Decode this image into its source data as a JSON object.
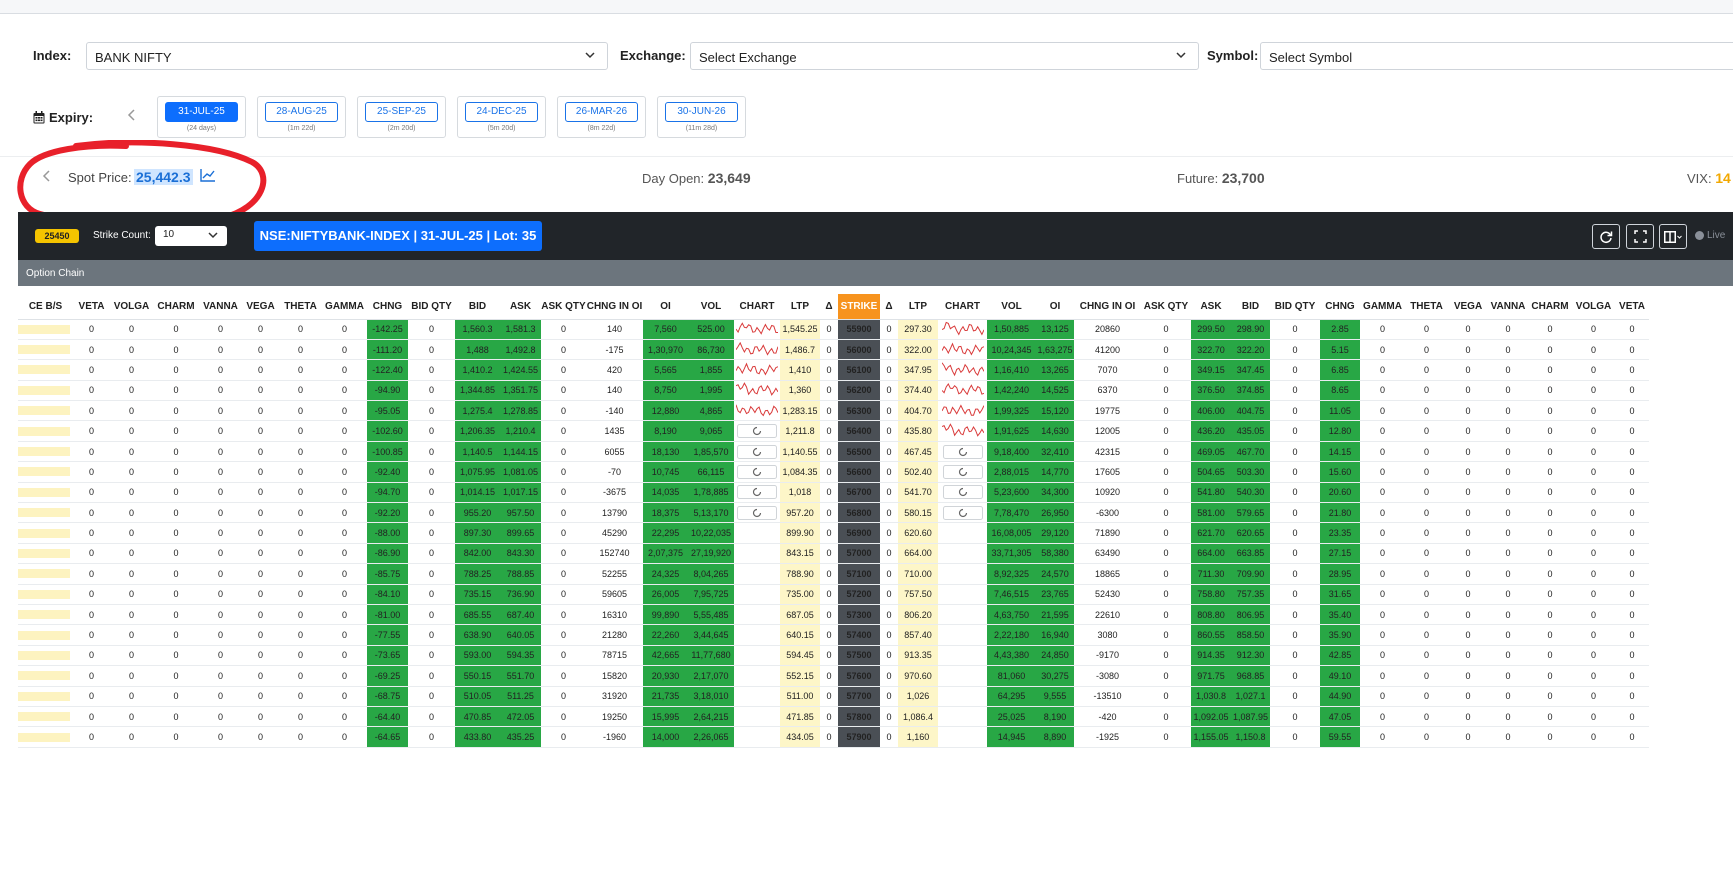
{
  "filters": {
    "index_label": "Index:",
    "index_value": "BANK NIFTY",
    "exchange_label": "Exchange:",
    "exchange_placeholder": "Select Exchange",
    "symbol_label": "Symbol:",
    "symbol_placeholder": "Select Symbol"
  },
  "expiry": {
    "label": "Expiry:",
    "items": [
      {
        "date": "31-JUL-25",
        "sub": "(24 days)",
        "active": true
      },
      {
        "date": "28-AUG-25",
        "sub": "(1m 22d)",
        "active": false
      },
      {
        "date": "25-SEP-25",
        "sub": "(2m 20d)",
        "active": false
      },
      {
        "date": "24-DEC-25",
        "sub": "(5m 20d)",
        "active": false
      },
      {
        "date": "26-MAR-26",
        "sub": "(8m 22d)",
        "active": false
      },
      {
        "date": "30-JUN-26",
        "sub": "(11m 28d)",
        "active": false
      }
    ]
  },
  "spot": {
    "label": "Spot Price:",
    "value": "25,442.3",
    "day_open_label": "Day Open:",
    "day_open_value": "23,649",
    "future_label": "Future:",
    "future_value": "23,700",
    "vix_label": "VIX:",
    "vix_value": "14"
  },
  "toolbar": {
    "spot_badge": "25450",
    "strike_count_label": "Strike Count:",
    "strike_count_value": "10",
    "instrument": "NSE:NIFTYBANK-INDEX | 31-JUL-25 | Lot: 35",
    "live_label": "Live"
  },
  "option_chain": {
    "title": "Option Chain",
    "columns": [
      "CE B/S",
      "VETA",
      "VOLGA",
      "CHARM",
      "VANNA",
      "VEGA",
      "THETA",
      "GAMMA",
      "CHNG",
      "BID QTY",
      "BID",
      "ASK",
      "ASK QTY",
      "CHNG IN OI",
      "OI",
      "VOL",
      "CHART",
      "LTP",
      "Δ",
      "STRIKE",
      "Δ",
      "LTP",
      "CHART",
      "VOL",
      "OI",
      "CHNG IN OI",
      "ASK QTY",
      "ASK",
      "BID",
      "BID QTY",
      "CHNG",
      "GAMMA",
      "THETA",
      "VEGA",
      "VANNA",
      "CHARM",
      "VOLGA",
      "VETA"
    ],
    "rows": [
      {
        "strike": "55900",
        "ce_chng": "-142.25",
        "ce_bid": "1,560.3",
        "ce_ask": "1,581.3",
        "ce_coi": "140",
        "ce_oi": "7,560",
        "ce_vol": "525.00",
        "ce_chart": "spark",
        "ce_ltp": "1,545.25",
        "pe_ltp": "297.30",
        "pe_chart": "spark",
        "pe_vol": "1,50,885",
        "pe_oi": "13,125",
        "pe_coi": "20860",
        "pe_ask": "299.50",
        "pe_bid": "298.90",
        "pe_chng": "2.85"
      },
      {
        "strike": "56000",
        "ce_chng": "-111.20",
        "ce_bid": "1,488",
        "ce_ask": "1,492.8",
        "ce_coi": "-175",
        "ce_oi": "1,30,970",
        "ce_vol": "86,730",
        "ce_chart": "spark",
        "ce_ltp": "1,486.7",
        "pe_ltp": "322.00",
        "pe_chart": "spark",
        "pe_vol": "10,24,345",
        "pe_oi": "1,63,275",
        "pe_coi": "41200",
        "pe_ask": "322.70",
        "pe_bid": "322.20",
        "pe_chng": "5.15"
      },
      {
        "strike": "56100",
        "ce_chng": "-122.40",
        "ce_bid": "1,410.2",
        "ce_ask": "1,424.55",
        "ce_coi": "420",
        "ce_oi": "5,565",
        "ce_vol": "1,855",
        "ce_chart": "spark",
        "ce_ltp": "1,410",
        "pe_ltp": "347.95",
        "pe_chart": "spark",
        "pe_vol": "1,16,410",
        "pe_oi": "13,265",
        "pe_coi": "7070",
        "pe_ask": "349.15",
        "pe_bid": "347.45",
        "pe_chng": "6.85"
      },
      {
        "strike": "56200",
        "ce_chng": "-94.90",
        "ce_bid": "1,344.85",
        "ce_ask": "1,351.75",
        "ce_coi": "140",
        "ce_oi": "8,750",
        "ce_vol": "1,995",
        "ce_chart": "spark",
        "ce_ltp": "1,360",
        "pe_ltp": "374.40",
        "pe_chart": "spark",
        "pe_vol": "1,42,240",
        "pe_oi": "14,525",
        "pe_coi": "6370",
        "pe_ask": "376.50",
        "pe_bid": "374.85",
        "pe_chng": "8.65"
      },
      {
        "strike": "56300",
        "ce_chng": "-95.05",
        "ce_bid": "1,275.4",
        "ce_ask": "1,278.85",
        "ce_coi": "-140",
        "ce_oi": "12,880",
        "ce_vol": "4,865",
        "ce_chart": "spark",
        "ce_ltp": "1,283.15",
        "pe_ltp": "404.70",
        "pe_chart": "spark",
        "pe_vol": "1,99,325",
        "pe_oi": "15,120",
        "pe_coi": "19775",
        "pe_ask": "406.00",
        "pe_bid": "404.75",
        "pe_chng": "11.05"
      },
      {
        "strike": "56400",
        "ce_chng": "-102.60",
        "ce_bid": "1,206.35",
        "ce_ask": "1,210.4",
        "ce_coi": "1435",
        "ce_oi": "8,190",
        "ce_vol": "9,065",
        "ce_chart": "spin",
        "ce_ltp": "1,211.8",
        "pe_ltp": "435.80",
        "pe_chart": "spark",
        "pe_vol": "1,91,625",
        "pe_oi": "14,630",
        "pe_coi": "12005",
        "pe_ask": "436.20",
        "pe_bid": "435.05",
        "pe_chng": "12.80"
      },
      {
        "strike": "56500",
        "ce_chng": "-100.85",
        "ce_bid": "1,140.5",
        "ce_ask": "1,144.15",
        "ce_coi": "6055",
        "ce_oi": "18,130",
        "ce_vol": "1,85,570",
        "ce_chart": "spin",
        "ce_ltp": "1,140.55",
        "pe_ltp": "467.45",
        "pe_chart": "spin",
        "pe_vol": "9,18,400",
        "pe_oi": "32,410",
        "pe_coi": "42315",
        "pe_ask": "469.05",
        "pe_bid": "467.70",
        "pe_chng": "14.15"
      },
      {
        "strike": "56600",
        "ce_chng": "-92.40",
        "ce_bid": "1,075.95",
        "ce_ask": "1,081.05",
        "ce_coi": "-70",
        "ce_oi": "10,745",
        "ce_vol": "66,115",
        "ce_chart": "spin",
        "ce_ltp": "1,084.35",
        "pe_ltp": "502.40",
        "pe_chart": "spin",
        "pe_vol": "2,88,015",
        "pe_oi": "14,770",
        "pe_coi": "17605",
        "pe_ask": "504.65",
        "pe_bid": "503.30",
        "pe_chng": "15.60"
      },
      {
        "strike": "56700",
        "ce_chng": "-94.70",
        "ce_bid": "1,014.15",
        "ce_ask": "1,017.15",
        "ce_coi": "-3675",
        "ce_oi": "14,035",
        "ce_vol": "1,78,885",
        "ce_chart": "spin",
        "ce_ltp": "1,018",
        "pe_ltp": "541.70",
        "pe_chart": "spin",
        "pe_vol": "5,23,600",
        "pe_oi": "34,300",
        "pe_coi": "10920",
        "pe_ask": "541.80",
        "pe_bid": "540.30",
        "pe_chng": "20.60"
      },
      {
        "strike": "56800",
        "ce_chng": "-92.20",
        "ce_bid": "955.20",
        "ce_ask": "957.50",
        "ce_coi": "13790",
        "ce_oi": "18,375",
        "ce_vol": "5,13,170",
        "ce_chart": "spin",
        "ce_ltp": "957.20",
        "pe_ltp": "580.15",
        "pe_chart": "spin",
        "pe_vol": "7,78,470",
        "pe_oi": "26,950",
        "pe_coi": "-6300",
        "pe_ask": "581.00",
        "pe_bid": "579.65",
        "pe_chng": "21.80"
      },
      {
        "strike": "56900",
        "ce_chng": "-88.00",
        "ce_bid": "897.30",
        "ce_ask": "899.65",
        "ce_coi": "45290",
        "ce_oi": "22,295",
        "ce_vol": "10,22,035",
        "ce_chart": "",
        "ce_ltp": "899.90",
        "pe_ltp": "620.60",
        "pe_chart": "",
        "pe_vol": "16,08,005",
        "pe_oi": "29,120",
        "pe_coi": "71890",
        "pe_ask": "621.70",
        "pe_bid": "620.65",
        "pe_chng": "23.35"
      },
      {
        "strike": "57000",
        "ce_chng": "-86.90",
        "ce_bid": "842.00",
        "ce_ask": "843.30",
        "ce_coi": "152740",
        "ce_oi": "2,07,375",
        "ce_vol": "27,19,920",
        "ce_chart": "",
        "ce_ltp": "843.15",
        "pe_ltp": "664.00",
        "pe_chart": "",
        "pe_vol": "33,71,305",
        "pe_oi": "58,380",
        "pe_coi": "63490",
        "pe_ask": "664.00",
        "pe_bid": "663.85",
        "pe_chng": "27.15"
      },
      {
        "strike": "57100",
        "ce_chng": "-85.75",
        "ce_bid": "788.25",
        "ce_ask": "788.85",
        "ce_coi": "52255",
        "ce_oi": "24,325",
        "ce_vol": "8,04,265",
        "ce_chart": "",
        "ce_ltp": "788.90",
        "pe_ltp": "710.00",
        "pe_chart": "",
        "pe_vol": "8,92,325",
        "pe_oi": "24,570",
        "pe_coi": "18865",
        "pe_ask": "711.30",
        "pe_bid": "709.90",
        "pe_chng": "28.95"
      },
      {
        "strike": "57200",
        "ce_chng": "-84.10",
        "ce_bid": "735.15",
        "ce_ask": "736.90",
        "ce_coi": "59605",
        "ce_oi": "26,005",
        "ce_vol": "7,95,725",
        "ce_chart": "",
        "ce_ltp": "735.00",
        "pe_ltp": "757.50",
        "pe_chart": "",
        "pe_vol": "7,46,515",
        "pe_oi": "23,765",
        "pe_coi": "52430",
        "pe_ask": "758.80",
        "pe_bid": "757.35",
        "pe_chng": "31.65"
      },
      {
        "strike": "57300",
        "ce_chng": "-81.00",
        "ce_bid": "685.55",
        "ce_ask": "687.40",
        "ce_coi": "16310",
        "ce_oi": "99,890",
        "ce_vol": "5,55,485",
        "ce_chart": "",
        "ce_ltp": "687.05",
        "pe_ltp": "806.20",
        "pe_chart": "",
        "pe_vol": "4,63,750",
        "pe_oi": "21,595",
        "pe_coi": "22610",
        "pe_ask": "808.80",
        "pe_bid": "806.95",
        "pe_chng": "35.40"
      },
      {
        "strike": "57400",
        "ce_chng": "-77.55",
        "ce_bid": "638.90",
        "ce_ask": "640.05",
        "ce_coi": "21280",
        "ce_oi": "22,260",
        "ce_vol": "3,44,645",
        "ce_chart": "",
        "ce_ltp": "640.15",
        "pe_ltp": "857.40",
        "pe_chart": "",
        "pe_vol": "2,22,180",
        "pe_oi": "16,940",
        "pe_coi": "3080",
        "pe_ask": "860.55",
        "pe_bid": "858.50",
        "pe_chng": "35.90"
      },
      {
        "strike": "57500",
        "ce_chng": "-73.65",
        "ce_bid": "593.00",
        "ce_ask": "594.35",
        "ce_coi": "78715",
        "ce_oi": "42,665",
        "ce_vol": "11,77,680",
        "ce_chart": "",
        "ce_ltp": "594.45",
        "pe_ltp": "913.35",
        "pe_chart": "",
        "pe_vol": "4,43,380",
        "pe_oi": "24,850",
        "pe_coi": "-9170",
        "pe_ask": "914.35",
        "pe_bid": "912.30",
        "pe_chng": "42.85"
      },
      {
        "strike": "57600",
        "ce_chng": "-69.25",
        "ce_bid": "550.15",
        "ce_ask": "551.70",
        "ce_coi": "15820",
        "ce_oi": "20,930",
        "ce_vol": "2,17,070",
        "ce_chart": "",
        "ce_ltp": "552.15",
        "pe_ltp": "970.60",
        "pe_chart": "",
        "pe_vol": "81,060",
        "pe_oi": "30,275",
        "pe_coi": "-3080",
        "pe_ask": "971.75",
        "pe_bid": "968.85",
        "pe_chng": "49.10"
      },
      {
        "strike": "57700",
        "ce_chng": "-68.75",
        "ce_bid": "510.05",
        "ce_ask": "511.25",
        "ce_coi": "31920",
        "ce_oi": "21,735",
        "ce_vol": "3,18,010",
        "ce_chart": "",
        "ce_ltp": "511.00",
        "pe_ltp": "1,026",
        "pe_chart": "",
        "pe_vol": "64,295",
        "pe_oi": "9,555",
        "pe_coi": "-13510",
        "pe_ask": "1,030.8",
        "pe_bid": "1,027.1",
        "pe_chng": "44.90"
      },
      {
        "strike": "57800",
        "ce_chng": "-64.40",
        "ce_bid": "470.85",
        "ce_ask": "472.05",
        "ce_coi": "19250",
        "ce_oi": "15,995",
        "ce_vol": "2,64,215",
        "ce_chart": "",
        "ce_ltp": "471.85",
        "pe_ltp": "1,086.4",
        "pe_chart": "",
        "pe_vol": "25,025",
        "pe_oi": "8,190",
        "pe_coi": "-420",
        "pe_ask": "1,092.05",
        "pe_bid": "1,087.95",
        "pe_chng": "47.05"
      },
      {
        "strike": "57900",
        "ce_chng": "-64.65",
        "ce_bid": "433.80",
        "ce_ask": "435.25",
        "ce_coi": "-1960",
        "ce_oi": "14,000",
        "ce_vol": "2,26,065",
        "ce_chart": "",
        "ce_ltp": "434.05",
        "pe_ltp": "1,160",
        "pe_chart": "",
        "pe_vol": "14,945",
        "pe_oi": "8,890",
        "pe_coi": "-1925",
        "pe_ask": "1,155.05",
        "pe_bid": "1,150.8",
        "pe_chng": "59.55"
      }
    ],
    "zero_value": "0"
  },
  "colors": {
    "accent_blue": "#0d6efd",
    "positive_green": "#28a745",
    "strike_orange": "#f7931e",
    "annotation_red": "#e8202a",
    "ltp_highlight": "#fdf6c8",
    "sparkline_red": "#d93a3a"
  },
  "icons": {
    "calendar": "calendar-icon",
    "chevron_left": "chevron-left-icon",
    "chevron_down": "chevron-down-icon",
    "chart": "chart-line-icon",
    "refresh": "refresh-icon",
    "fullscreen": "fullscreen-icon",
    "columns": "columns-icon",
    "spinner": "spinner-icon",
    "sparkline": "sparkline-icon"
  }
}
